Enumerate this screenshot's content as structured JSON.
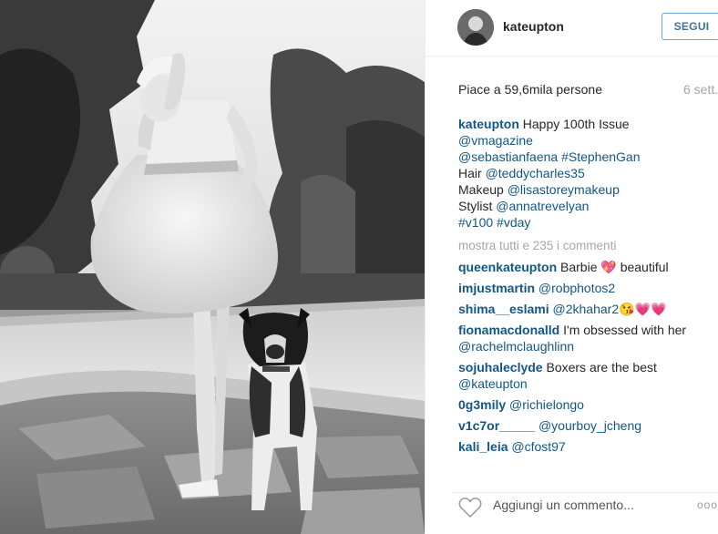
{
  "post": {
    "username": "kateupton",
    "follow_label": "Segui",
    "likes": "Piace a 59,6mila persone",
    "timestamp": "6 sett.",
    "caption": {
      "author": "kateupton",
      "text": "Happy 100th Issue",
      "lines": [
        [
          {
            "t": "@vmagazine",
            "link": true
          }
        ],
        [
          {
            "t": "@sebastianfaena",
            "link": true
          },
          {
            "t": " ",
            "link": false
          },
          {
            "t": "#StephenGan",
            "link": true
          }
        ],
        [
          {
            "t": "Hair ",
            "link": false
          },
          {
            "t": "@teddycharles35",
            "link": true
          }
        ],
        [
          {
            "t": "Makeup ",
            "link": false
          },
          {
            "t": "@lisastoreymakeup",
            "link": true
          }
        ],
        [
          {
            "t": "Stylist ",
            "link": false
          },
          {
            "t": "@annatrevelyan",
            "link": true
          }
        ],
        [
          {
            "t": "#v100",
            "link": true
          },
          {
            "t": " ",
            "link": false
          },
          {
            "t": "#vday",
            "link": true
          }
        ]
      ]
    },
    "more_comments": "mostra tutti e 235 i commenti",
    "comments": [
      {
        "user": "queenkateupton",
        "text": "Barbie 💖 beautiful",
        "link": false
      },
      {
        "user": "imjustmartin",
        "text": "@robphotos2",
        "link": true
      },
      {
        "user": "shima__eslami",
        "text": "@2khahar2😘💗💗",
        "link": true
      },
      {
        "user": "fionamacdonalld",
        "text": "I'm obsessed with her @rachelmclaughlinn",
        "link": false,
        "mention": "@rachelmclaughlinn",
        "prefix": "I'm obsessed with her "
      },
      {
        "user": "sojuhaleclyde",
        "text": "Boxers are the best @kateupton",
        "link": false,
        "mention": "@kateupton",
        "prefix": "Boxers are the best "
      },
      {
        "user": "0g3mily",
        "text": "@richielongo",
        "link": true
      },
      {
        "user": "v1c7or_____",
        "text": "@yourboy_jcheng",
        "link": true
      },
      {
        "user": "kali_leia",
        "text": "@cfost97",
        "link": true
      }
    ],
    "add_comment_placeholder": "Aggiungi un commento...",
    "more_options": "ooo"
  },
  "icons": {
    "like": "heart-icon",
    "options": "more-options-icon",
    "avatar": "profile-avatar"
  },
  "colors": {
    "link": "#125688",
    "follow_border": "#70a4d8",
    "muted": "#a5a7aa"
  }
}
